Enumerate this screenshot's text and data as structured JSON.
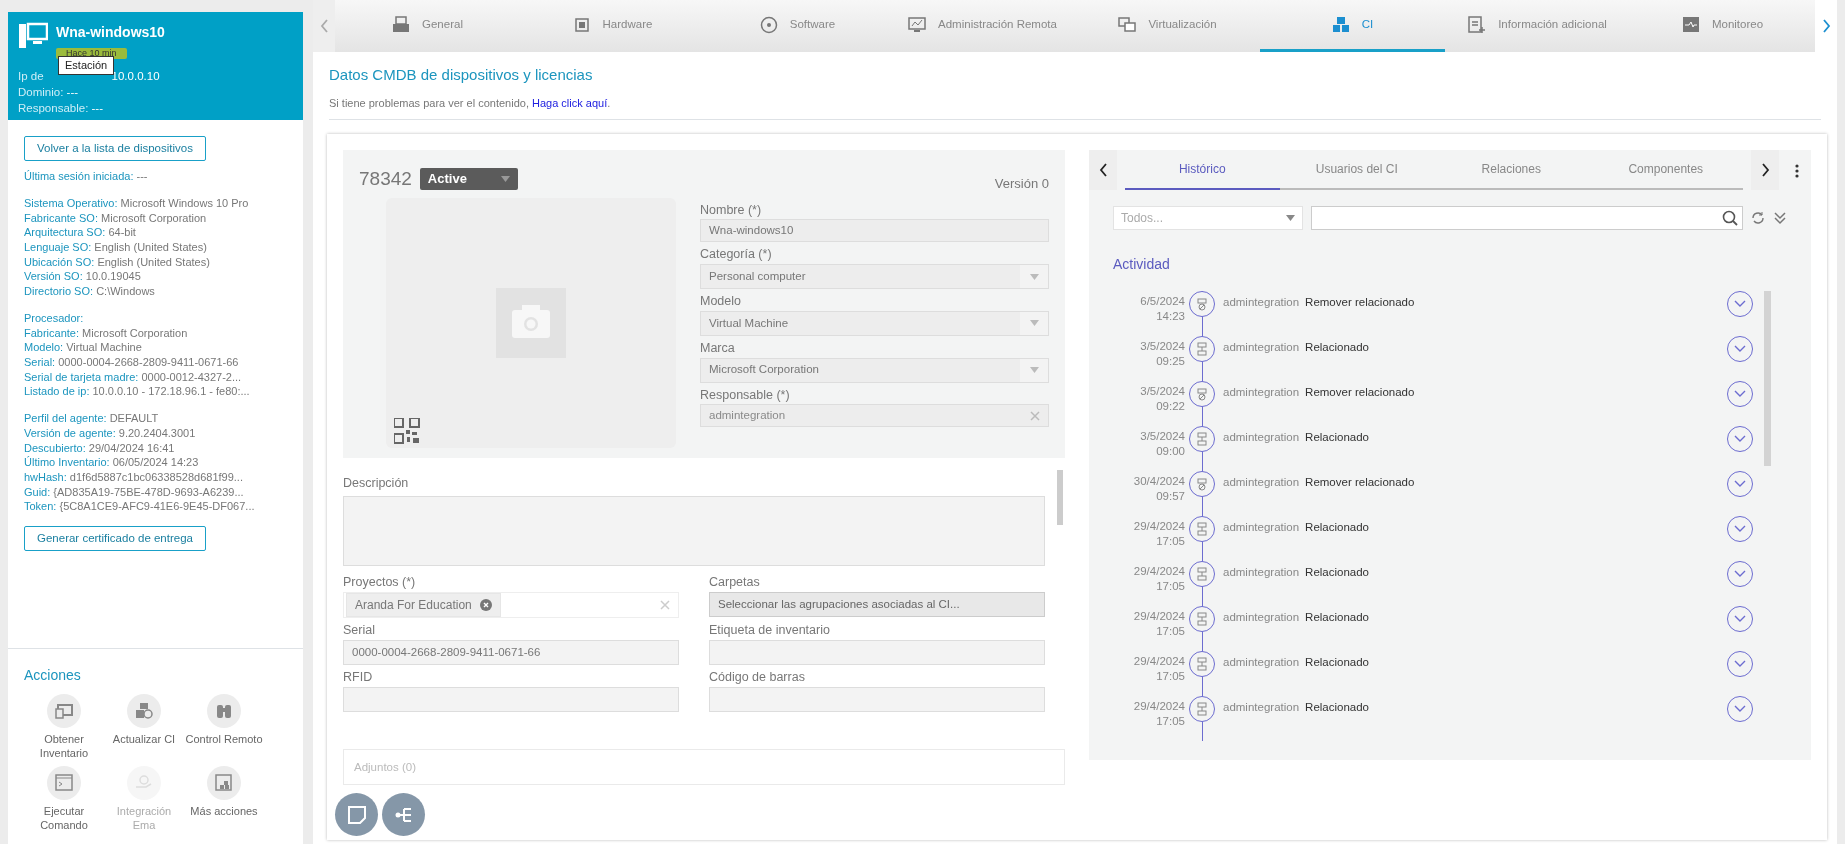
{
  "device": {
    "name": "Wna-windows10",
    "badge": "Hace 10 min",
    "tooltip": "Estación",
    "ip_label": "Ip de",
    "ip_value": "10.0.0.10",
    "lines": [
      {
        "label": "Dominio:",
        "value": "---"
      },
      {
        "label": "Responsable:",
        "value": "---"
      }
    ]
  },
  "back_button": "Volver a la lista de dispositivos",
  "info_groups": [
    [
      {
        "label": "Última sesión iniciada:",
        "value": "---"
      }
    ],
    [
      {
        "label": "Sistema Operativo:",
        "value": "Microsoft Windows 10 Pro"
      },
      {
        "label": "Fabricante SO:",
        "value": "Microsoft Corporation"
      },
      {
        "label": "Arquitectura SO:",
        "value": "64-bit"
      },
      {
        "label": "Lenguaje SO:",
        "value": "English (United States)"
      },
      {
        "label": "Ubicación SO:",
        "value": "English (United States)"
      },
      {
        "label": "Versión SO:",
        "value": "10.0.19045"
      },
      {
        "label": "Directorio SO:",
        "value": "C:\\Windows"
      }
    ],
    [
      {
        "label": "Procesador:"
      },
      {
        "label": "Fabricante:",
        "value": "Microsoft Corporation"
      },
      {
        "label": "Modelo:",
        "value": "Virtual Machine"
      },
      {
        "label": "Serial:",
        "value": "0000-0004-2668-2809-9411-0671-66"
      },
      {
        "label": "Serial de tarjeta madre:",
        "value": "0000-0012-4327-2..."
      },
      {
        "label": "Listado de ip:",
        "value": "10.0.0.10 - 172.18.96.1 - fe80:..."
      }
    ],
    [
      {
        "label": "Perfil del agente:",
        "value": "DEFAULT"
      },
      {
        "label": "Versión de agente:",
        "value": "9.20.2404.3001"
      },
      {
        "label": "Descubierto:",
        "value": "29/04/2024 16:41"
      },
      {
        "label": "Último Inventario:",
        "value": "06/05/2024 14:23"
      },
      {
        "label": "hwHash:",
        "value": "d1f6d5887c1bc06338528d681f99..."
      },
      {
        "label": "Guid:",
        "value": "{AD835A19-75BE-478D-9693-A6239..."
      },
      {
        "label": "Token:",
        "value": "{5C8A1CE9-AFC9-41E6-9E45-DF067..."
      }
    ]
  ],
  "certificate_button": "Generar certificado de entrega",
  "actions": {
    "title": "Acciones",
    "items": [
      {
        "label": "Obtener Inventario",
        "disabled": false
      },
      {
        "label": "Actualizar CI",
        "disabled": false
      },
      {
        "label": "Control Remoto",
        "disabled": false
      },
      {
        "label": "Ejecutar Comando",
        "disabled": false
      },
      {
        "label": "Integración Ema",
        "disabled": true
      },
      {
        "label": "Más acciones",
        "disabled": false
      }
    ]
  },
  "tabs": [
    {
      "label": "General",
      "selected": false
    },
    {
      "label": "Hardware",
      "selected": false
    },
    {
      "label": "Software",
      "selected": false
    },
    {
      "label": "Administración Remota",
      "selected": false
    },
    {
      "label": "Virtualización",
      "selected": false
    },
    {
      "label": "CI",
      "selected": true
    },
    {
      "label": "Información adicional",
      "selected": false
    },
    {
      "label": "Monitoreo",
      "selected": false
    }
  ],
  "page": {
    "title": "Datos CMDB de dispositivos y licencias",
    "notice": "Si tiene problemas para ver el contenido,",
    "link": "Haga click aquí",
    "notice_end": "."
  },
  "ci": {
    "id": "78342",
    "status": "Active",
    "version": "Versión 0",
    "fields": [
      {
        "label": "Nombre (*)",
        "value": "Wna-windows10",
        "kind": "text"
      },
      {
        "label": "Categoría (*)",
        "value": "Personal computer",
        "kind": "select"
      },
      {
        "label": "Modelo",
        "value": "Virtual Machine",
        "kind": "select"
      },
      {
        "label": "Marca",
        "value": "Microsoft Corporation",
        "kind": "select"
      },
      {
        "label": "Responsable (*)",
        "value": "admintegration",
        "kind": "clear"
      }
    ],
    "description_label": "Descripción",
    "grid_fields": [
      {
        "label": "Proyectos (*)",
        "kind": "tags",
        "tags": [
          "Aranda For Education"
        ]
      },
      {
        "label": "Carpetas",
        "kind": "picker",
        "value": "Seleccionar las agrupaciones asociadas al CI..."
      },
      {
        "label": "Serial",
        "kind": "text",
        "value": "0000-0004-2668-2809-9411-0671-66"
      },
      {
        "label": "Etiqueta de inventario",
        "kind": "text"
      },
      {
        "label": "RFID",
        "kind": "text"
      },
      {
        "label": "Código de barras",
        "kind": "text"
      }
    ],
    "attachments": "Adjuntos (0)"
  },
  "history": {
    "tabs": [
      {
        "label": "Histórico",
        "selected": true
      },
      {
        "label": "Usuarios del CI",
        "selected": false
      },
      {
        "label": "Relaciones",
        "selected": false
      },
      {
        "label": "Componentes",
        "selected": false
      }
    ],
    "filter_placeholder": "Todos...",
    "section": "Actividad",
    "events": [
      {
        "date": "6/5/2024",
        "time": "14:23",
        "user": "admintegration",
        "action": "Remover relacionado",
        "kind": "remove"
      },
      {
        "date": "3/5/2024",
        "time": "09:25",
        "user": "admintegration",
        "action": "Relacionado",
        "kind": "relate"
      },
      {
        "date": "3/5/2024",
        "time": "09:22",
        "user": "admintegration",
        "action": "Remover relacionado",
        "kind": "remove"
      },
      {
        "date": "3/5/2024",
        "time": "09:00",
        "user": "admintegration",
        "action": "Relacionado",
        "kind": "relate"
      },
      {
        "date": "30/4/2024",
        "time": "09:57",
        "user": "admintegration",
        "action": "Remover relacionado",
        "kind": "remove"
      },
      {
        "date": "29/4/2024",
        "time": "17:05",
        "user": "admintegration",
        "action": "Relacionado",
        "kind": "relate"
      },
      {
        "date": "29/4/2024",
        "time": "17:05",
        "user": "admintegration",
        "action": "Relacionado",
        "kind": "relate"
      },
      {
        "date": "29/4/2024",
        "time": "17:05",
        "user": "admintegration",
        "action": "Relacionado",
        "kind": "relate"
      },
      {
        "date": "29/4/2024",
        "time": "17:05",
        "user": "admintegration",
        "action": "Relacionado",
        "kind": "relate"
      },
      {
        "date": "29/4/2024",
        "time": "17:05",
        "user": "admintegration",
        "action": "Relacionado",
        "kind": "relate"
      }
    ]
  }
}
